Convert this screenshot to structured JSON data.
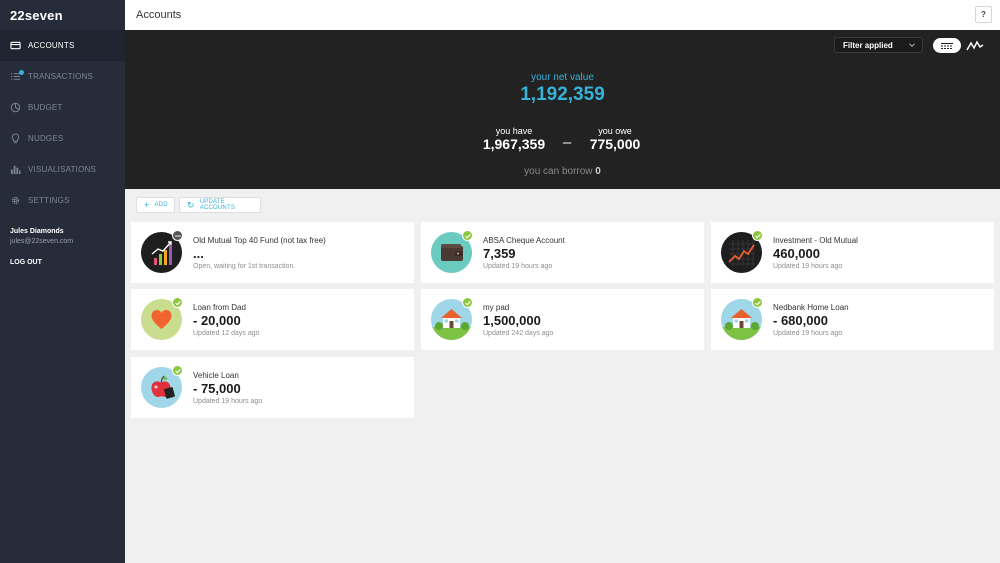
{
  "app": {
    "logo": "22seven"
  },
  "sidebar": {
    "items": [
      {
        "label": "ACCOUNTS",
        "icon": "card-icon",
        "active": true
      },
      {
        "label": "TRANSACTIONS",
        "icon": "list-icon"
      },
      {
        "label": "BUDGET",
        "icon": "budget-icon"
      },
      {
        "label": "NUDGES",
        "icon": "lightbulb-icon"
      },
      {
        "label": "VISUALISATIONS",
        "icon": "bar-chart-icon"
      },
      {
        "label": "SETTINGS",
        "icon": "gear-icon"
      }
    ],
    "user": {
      "name": "Jules Diamonds",
      "email": "jules@22seven.com"
    },
    "logout": "LOG OUT"
  },
  "header": {
    "title": "Accounts",
    "help": "?"
  },
  "hero": {
    "filter": "Filter applied",
    "net_label": "your net value",
    "net_value": "1,192,359",
    "have_label": "you have",
    "have_value": "1,967,359",
    "minus": "–",
    "owe_label": "you owe",
    "owe_value": "775,000",
    "borrow_label": "you can borrow",
    "borrow_value": "0"
  },
  "actions": {
    "add": "ADD",
    "update": "UPDATE ACCOUNTS"
  },
  "accounts": [
    {
      "name": "Old Mutual Top 40 Fund (not tax free)",
      "amount": "...",
      "status": "Open, waiting for 1st transaction.",
      "icon": "growth-chart-icon",
      "badge": "pending"
    },
    {
      "name": "ABSA Cheque Account",
      "amount": "7,359",
      "status": "Updated 19 hours ago",
      "icon": "wallet-icon",
      "badge": "ok"
    },
    {
      "name": "Investment - Old Mutual",
      "amount": "460,000",
      "status": "Updated 19 hours ago",
      "icon": "investment-graph-icon",
      "badge": "ok"
    },
    {
      "name": "Loan from Dad",
      "amount": "- 20,000",
      "status": "Updated 12 days ago",
      "icon": "heart-icon",
      "badge": "ok"
    },
    {
      "name": "my pad",
      "amount": "1,500,000",
      "status": "Updated 242 days ago",
      "icon": "house-icon",
      "badge": "ok"
    },
    {
      "name": "Nedbank Home Loan",
      "amount": "- 680,000",
      "status": "Updated 19 hours ago",
      "icon": "house-icon",
      "badge": "ok"
    },
    {
      "name": "Vehicle Loan",
      "amount": "- 75,000",
      "status": "Updated 19 hours ago",
      "icon": "apple-icon",
      "badge": "ok"
    }
  ],
  "colors": {
    "accent": "#35b3d9",
    "sidebar": "#262c3a",
    "hero": "#222222",
    "badge_ok": "#8dc63f",
    "badge_pending": "#555555"
  }
}
